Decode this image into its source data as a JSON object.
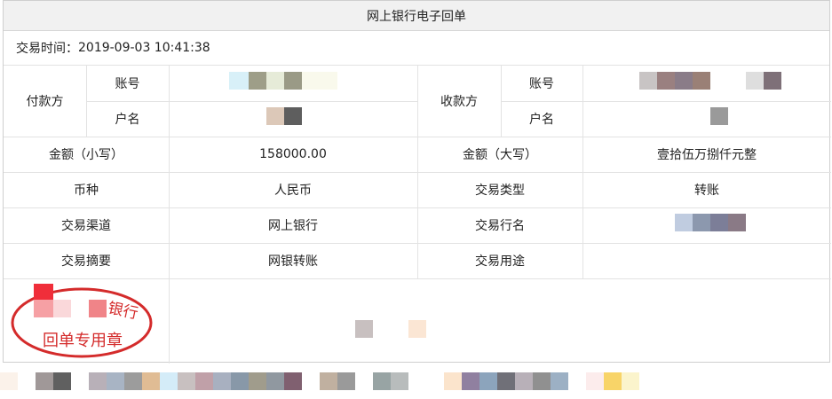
{
  "receipt": {
    "title": "网上银行电子回单",
    "time_label": "交易时间：",
    "time_value": "2019-09-03 10:41:38",
    "payer_label": "付款方",
    "payee_label": "收款方",
    "account_label": "账号",
    "name_label": "户名",
    "amount_lower_label": "金额（小写）",
    "amount_lower_value": "158000.00",
    "amount_upper_label": "金额（大写）",
    "amount_upper_value": "壹拾伍万捌仟元整",
    "currency_label": "币种",
    "currency_value": "人民币",
    "trade_type_label": "交易类型",
    "trade_type_value": "转账",
    "channel_label": "交易渠道",
    "channel_value": "网上银行",
    "bank_name_label": "交易行名",
    "summary_label": "交易摘要",
    "summary_value": "网银转账",
    "purpose_label": "交易用途",
    "purpose_value": ""
  },
  "stamp": {
    "bank_text": "银行",
    "seal_text": "回单专用章",
    "color": "#d42b2b"
  }
}
